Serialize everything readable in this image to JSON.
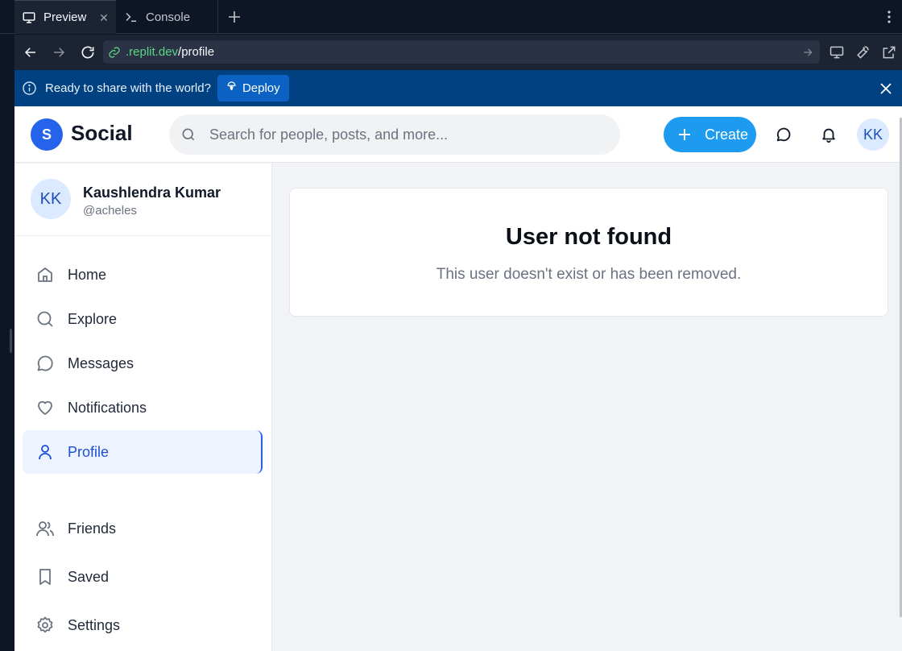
{
  "browser": {
    "tabs": [
      {
        "label": "Preview",
        "icon": "monitor-icon",
        "active": true
      },
      {
        "label": "Console",
        "icon": "terminal-icon",
        "active": false
      }
    ],
    "url": {
      "host": ".replit.dev",
      "path": "/profile"
    },
    "deploy_banner": {
      "message": "Ready to share with the world?",
      "button_label": "Deploy"
    }
  },
  "app": {
    "logo_letter": "S",
    "brand": "Social",
    "search_placeholder": "Search for people, posts, and more...",
    "create_label": "Create",
    "user": {
      "initials": "KK",
      "name": "Kaushlendra Kumar",
      "handle": "@acheles"
    },
    "nav": [
      {
        "label": "Home",
        "icon": "home-icon"
      },
      {
        "label": "Explore",
        "icon": "search-icon"
      },
      {
        "label": "Messages",
        "icon": "message-icon"
      },
      {
        "label": "Notifications",
        "icon": "heart-icon"
      },
      {
        "label": "Profile",
        "icon": "user-icon",
        "active": true
      },
      {
        "label": "Friends",
        "icon": "users-icon"
      },
      {
        "label": "Saved",
        "icon": "bookmark-icon"
      },
      {
        "label": "Settings",
        "icon": "gear-icon"
      }
    ],
    "error": {
      "title": "User not found",
      "message": "This user doesn't exist or has been removed."
    }
  },
  "colors": {
    "accent": "#1d9bf0",
    "brand": "#2563eb",
    "deploy_bar": "#004182",
    "url_host": "#5bd684"
  }
}
